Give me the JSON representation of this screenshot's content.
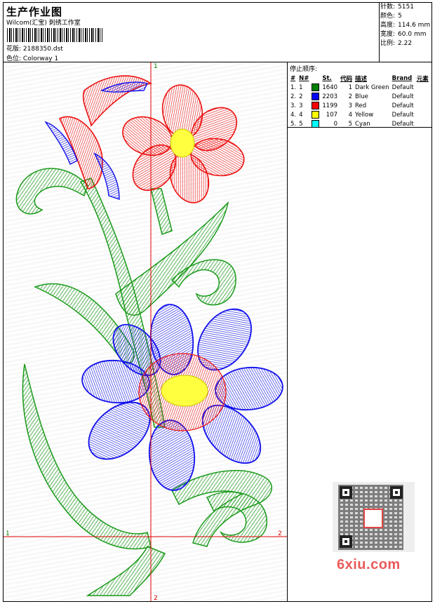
{
  "header": {
    "title": "生产作业图",
    "company": "Wilcom(汇宝) 刺绣工作室",
    "design_label": "花版:",
    "design_value": "2188350.dst",
    "colorway_label": "色位:",
    "colorway_value": "Colorway 1"
  },
  "specs": [
    {
      "label": "针数:",
      "value": "5151"
    },
    {
      "label": "颜色:",
      "value": "5"
    },
    {
      "label": "高度:",
      "value": "114.6 mm"
    },
    {
      "label": "宽度:",
      "value": "60.0 mm"
    },
    {
      "label": "比例:",
      "value": "2.22"
    }
  ],
  "stops": {
    "title": "停止顺序:",
    "headers": [
      "#",
      "N#",
      "St.",
      "代码",
      "描述",
      "Brand",
      "元素"
    ],
    "rows": [
      {
        "num": "1.",
        "n": "1",
        "color": "#008000",
        "st": "1640",
        "code": "1",
        "desc": "Dark Green",
        "brand": "Default"
      },
      {
        "num": "2.",
        "n": "2",
        "color": "#0000ff",
        "st": "2203",
        "code": "2",
        "desc": "Blue",
        "brand": "Default"
      },
      {
        "num": "3.",
        "n": "3",
        "color": "#ff0000",
        "st": "1199",
        "code": "3",
        "desc": "Red",
        "brand": "Default"
      },
      {
        "num": "4.",
        "n": "4",
        "color": "#ffff00",
        "st": "107",
        "code": "4",
        "desc": "Yellow",
        "brand": "Default"
      },
      {
        "num": "5.",
        "n": "5",
        "color": "#00ffff",
        "st": "0",
        "code": "5",
        "desc": "Cyan",
        "brand": "Default"
      }
    ]
  },
  "crosshair": {
    "top": "1",
    "bottom": "2",
    "left": "1",
    "right": "2",
    "color": "#e00000"
  },
  "watermark": "6xiu.com",
  "colors": {
    "green": "#1a9a1a",
    "blue": "#1010ee",
    "red": "#ee1010",
    "yellow": "#ffff40"
  }
}
